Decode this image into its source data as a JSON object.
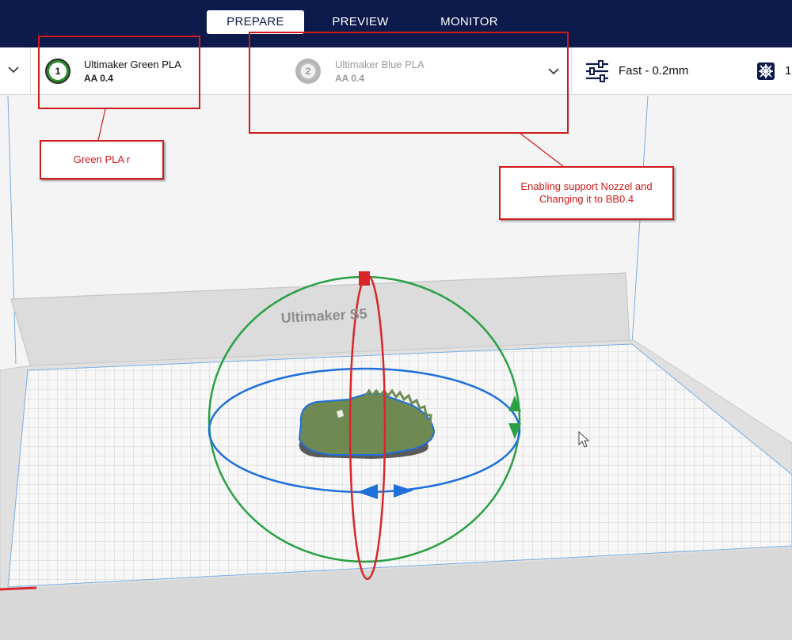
{
  "header": {
    "tabs": [
      {
        "label": "PREPARE",
        "active": true
      },
      {
        "label": "PREVIEW",
        "active": false
      },
      {
        "label": "MONITOR",
        "active": false
      }
    ]
  },
  "extruders": [
    {
      "number": "1",
      "material": "Ultimaker Green PLA",
      "nozzle": "AA 0.4",
      "color": "#2e8b2e",
      "enabled": true
    },
    {
      "number": "2",
      "material": "Ultimaker Blue PLA",
      "nozzle": "AA 0.4",
      "color": "#a9a9a9",
      "enabled": false
    }
  ],
  "print_setup": {
    "profile": "Fast - 0.2mm",
    "support_value": "1",
    "settings_icon": "sliders-icon",
    "support_icon": "support-grid-icon"
  },
  "viewport": {
    "printer_label": "Ultimaker S5"
  },
  "annotations": [
    {
      "text": "Green PLA r"
    },
    {
      "text": "Enabling support Nozzel and Changing it to BB0.4"
    }
  ],
  "colors": {
    "header_bg": "#0d1b4c",
    "annotation_red": "#d01a1a",
    "model_green": "#6e8a52",
    "rotate_red": "#d9262b",
    "rotate_green": "#2aa043",
    "rotate_blue": "#1f6fdb"
  }
}
